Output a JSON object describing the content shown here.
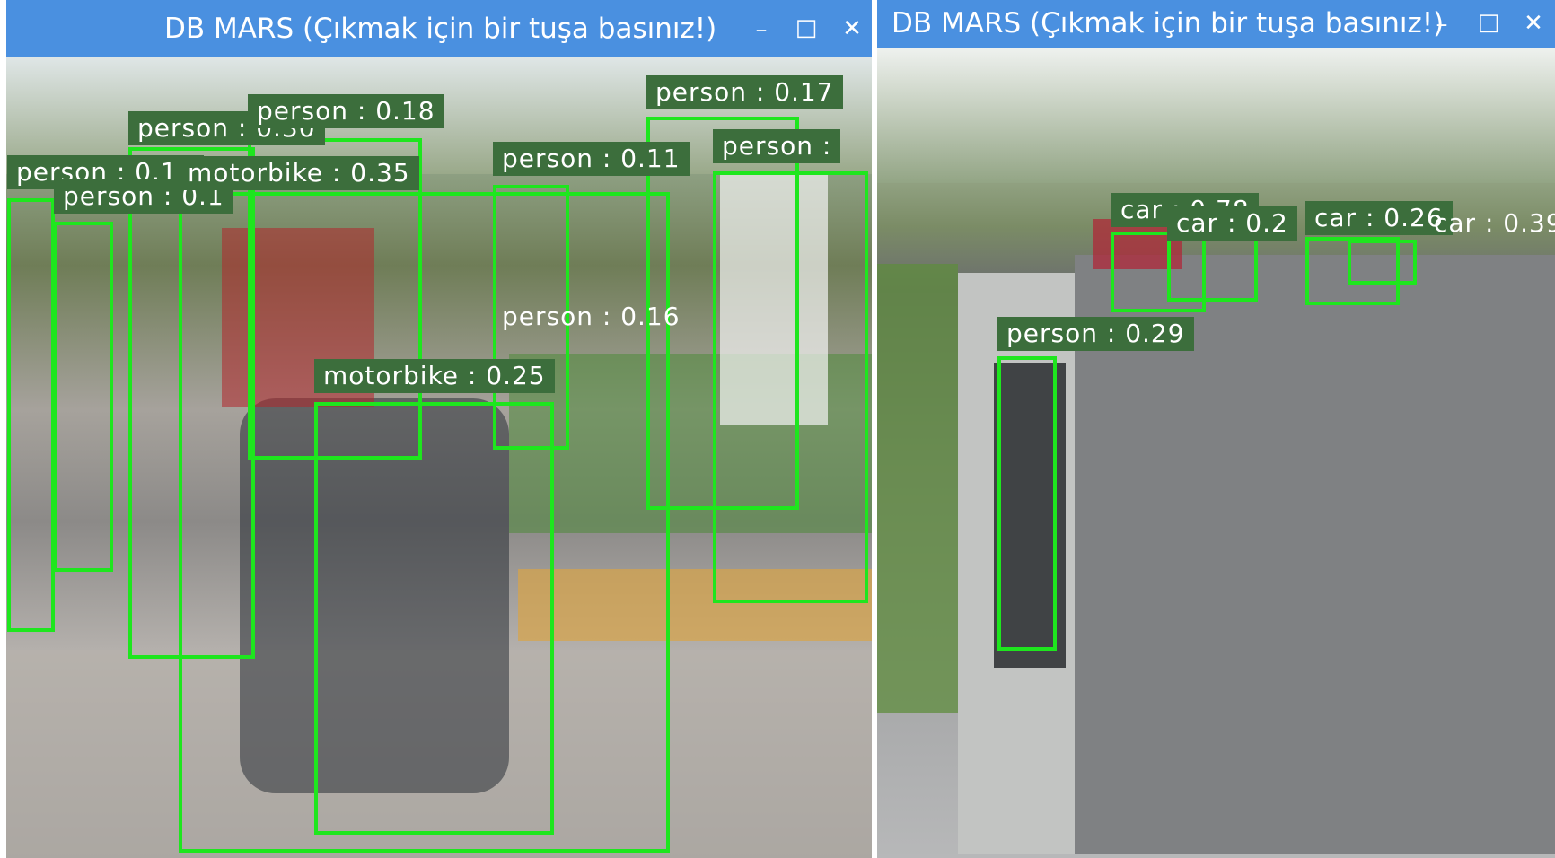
{
  "windows": [
    {
      "title": "DB MARS (Çıkmak için bir tuşa basınız!)",
      "controls": {
        "minimize": "–",
        "maximize": "□",
        "close": "✕"
      },
      "detections": [
        {
          "label": "person : 0.13"
        },
        {
          "label": "person : 0.18"
        },
        {
          "label": "person : 0.17"
        },
        {
          "label": "person : 0.11"
        },
        {
          "label": "person :"
        },
        {
          "label": "person : 0.30"
        },
        {
          "label": "motorbike : 0.35"
        },
        {
          "label": "person : 0.16"
        },
        {
          "label": "motorbike : 0.25"
        },
        {
          "label": "person : 0.1"
        }
      ]
    },
    {
      "title": "DB MARS (Çıkmak için bir tuşa basınız!)",
      "controls": {
        "minimize": "–",
        "maximize": "□",
        "close": "✕"
      },
      "detections": [
        {
          "label": "car : 0.78"
        },
        {
          "label": "car : 0.2"
        },
        {
          "label": "car : 0.26"
        },
        {
          "label": "car : 0.39"
        },
        {
          "label": "person : 0.29"
        }
      ]
    }
  ],
  "colors": {
    "titlebar": "#4a90e0",
    "box": "#1ee61e",
    "label_bg": "#3c6e3c",
    "label_text": "#ffffff"
  }
}
